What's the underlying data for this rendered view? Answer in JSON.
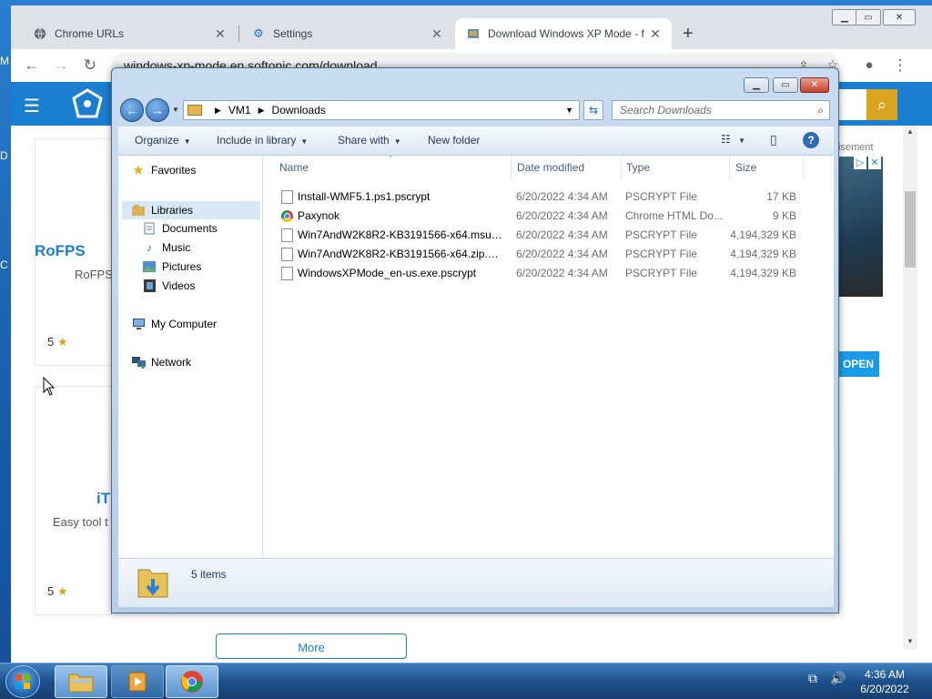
{
  "browser": {
    "tabs": [
      {
        "label": "Chrome URLs",
        "icon": "globe-icon"
      },
      {
        "label": "Settings",
        "icon": "gear-icon"
      },
      {
        "label": "Download Windows XP Mode - f",
        "icon": "softonic-favicon"
      }
    ],
    "url": "windows-xp-mode.en.softonic.com/download"
  },
  "site": {
    "cards": [
      {
        "title": "RoFPS",
        "subtitle": "RoFPS",
        "rating": "5"
      },
      {
        "title": "iT",
        "subtitle": "Easy tool t",
        "rating": "5"
      }
    ],
    "ad_label": "tisement",
    "ad_open": "OPEN",
    "more_label": "More"
  },
  "explorer": {
    "breadcrumb": [
      "VM1",
      "Downloads"
    ],
    "search_placeholder": "Search Downloads",
    "commands": [
      "Organize",
      "Include in library",
      "Share with",
      "New folder"
    ],
    "nav": {
      "favorites": "Favorites",
      "libraries": "Libraries",
      "library_items": [
        "Documents",
        "Music",
        "Pictures",
        "Videos"
      ],
      "computer": "My Computer",
      "network": "Network"
    },
    "columns": {
      "name": "Name",
      "date": "Date modified",
      "type": "Type",
      "size": "Size"
    },
    "files": [
      {
        "name": "Install-WMF5.1.ps1.pscrypt",
        "date": "6/20/2022 4:34 AM",
        "type": "PSCRYPT File",
        "size": "17 KB",
        "icon": "document-icon"
      },
      {
        "name": "Paxynok",
        "date": "6/20/2022 4:34 AM",
        "type": "Chrome HTML Do...",
        "size": "9 KB",
        "icon": "chrome-icon"
      },
      {
        "name": "Win7AndW2K8R2-KB3191566-x64.msu.ps...",
        "date": "6/20/2022 4:34 AM",
        "type": "PSCRYPT File",
        "size": "4,194,329 KB",
        "icon": "document-icon"
      },
      {
        "name": "Win7AndW2K8R2-KB3191566-x64.zip.psc...",
        "date": "6/20/2022 4:34 AM",
        "type": "PSCRYPT File",
        "size": "4,194,329 KB",
        "icon": "document-icon"
      },
      {
        "name": "WindowsXPMode_en-us.exe.pscrypt",
        "date": "6/20/2022 4:34 AM",
        "type": "PSCRYPT File",
        "size": "4,194,329 KB",
        "icon": "document-icon"
      }
    ],
    "status": "5 items"
  },
  "taskbar": {
    "time": "4:36 AM",
    "date": "6/20/2022"
  }
}
